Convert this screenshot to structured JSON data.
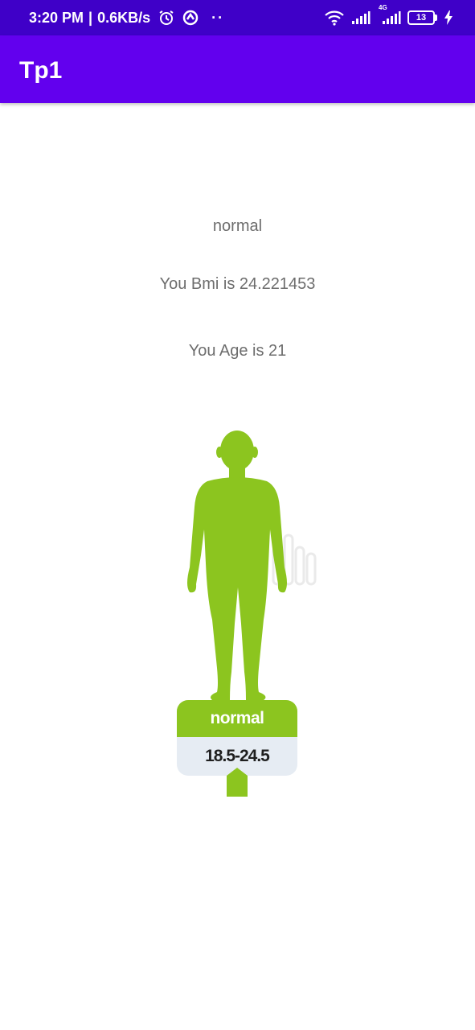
{
  "status_bar": {
    "time": "3:20 PM",
    "separator": "|",
    "speed": "0.6KB/s",
    "battery": "13",
    "network": "4G"
  },
  "app_bar": {
    "title": "Tp1"
  },
  "result": {
    "category": "normal",
    "bmi_text": "You Bmi is 24.221453",
    "age_text": "You Age is 21"
  },
  "illustration": {
    "label": "normal",
    "range": "18.5-24.5",
    "color": "#8cc51f"
  },
  "colors": {
    "status_bar": "#3f00c8",
    "app_bar": "#6200ee",
    "text": "#6d6d6d"
  }
}
